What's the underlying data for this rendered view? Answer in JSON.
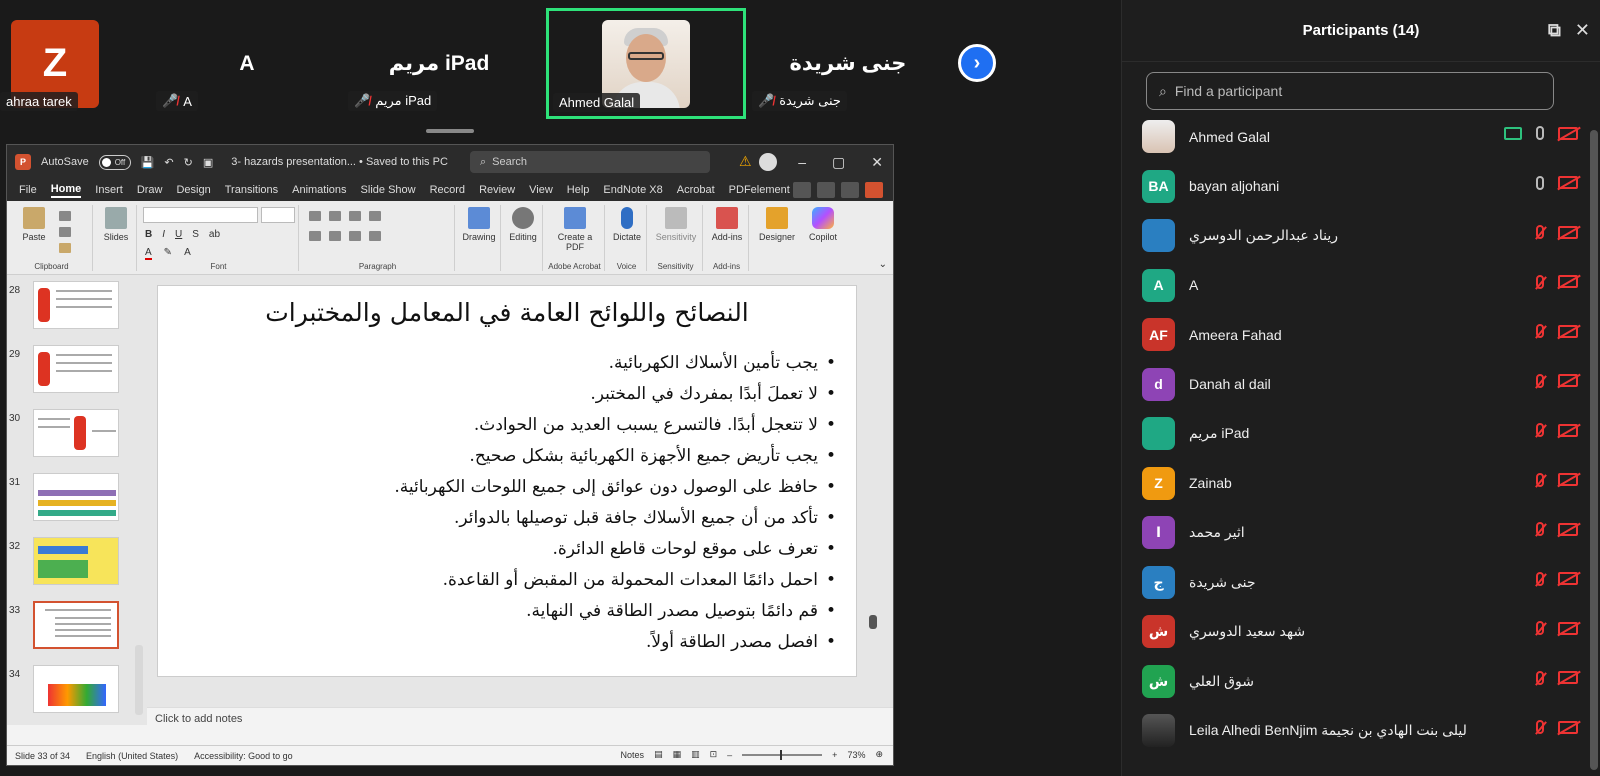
{
  "gallery": {
    "tiles": [
      {
        "name": "Z",
        "label": "ahraa tarek",
        "muted": false
      },
      {
        "name": "A",
        "label": "A",
        "muted": true
      },
      {
        "name": "مريم iPad",
        "label": "مريم iPad",
        "muted": true
      },
      {
        "name": "Ahmed Galal",
        "label": "Ahmed Galal",
        "muted": false,
        "active_speaker": true
      },
      {
        "name": "جنى شريدة",
        "label": "جنى شريدة",
        "muted": true
      }
    ],
    "next_icon": "chevron-right-icon"
  },
  "ppt": {
    "autosave_label": "AutoSave",
    "autosave_state": "Off",
    "file_title": "3- hazards presentation... • Saved to this PC",
    "search_placeholder": "Search",
    "menu": [
      "File",
      "Home",
      "Insert",
      "Draw",
      "Design",
      "Transitions",
      "Animations",
      "Slide Show",
      "Record",
      "Review",
      "View",
      "Help",
      "EndNote X8",
      "Acrobat",
      "PDFelement"
    ],
    "active_menu": "Home",
    "ribbon": {
      "paste": "Paste",
      "clipboard": "Clipboard",
      "slides": "Slides",
      "font": "Font",
      "paragraph": "Paragraph",
      "drawing": "Drawing",
      "editing": "Editing",
      "create_pdf": "Create a PDF",
      "adobe_acrobat": "Adobe Acrobat",
      "dictate": "Dictate",
      "voice": "Voice",
      "sensitivity": "Sensitivity",
      "addins": "Add-ins",
      "designer": "Designer",
      "copilot": "Copilot",
      "font_row": [
        "B",
        "I",
        "U",
        "S",
        "ab"
      ]
    },
    "thumbnails": [
      "28",
      "29",
      "30",
      "31",
      "32",
      "33",
      "34"
    ],
    "selected_thumbnail": "33",
    "slide": {
      "title": "النصائح واللوائح العامة في المعامل والمختبرات",
      "bullets": [
        "يجب تأمين الأسلاك الكهربائية.",
        "لا تعملَ أبدًا بمفردك في المختبر.",
        "لا تتعجل أبدًا. فالتسرع يسبب العديد من الحوادث.",
        "يجب تأريض جميع الأجهزة الكهربائية بشكل صحيح.",
        "حافظ على الوصول دون عوائق إلى جميع اللوحات الكهربائية.",
        "تأكد من أن جميع الأسلاك جافة قبل توصيلها بالدوائر.",
        "تعرف على موقع لوحات قاطع الدائرة.",
        "احمل دائمًا المعدات المحمولة من المقبض أو القاعدة.",
        "قم دائمًا بتوصيل مصدر الطاقة في النهاية.",
        "افصل مصدر الطاقة أولاً."
      ]
    },
    "notes_placeholder": "Click to add notes",
    "status": {
      "slide": "Slide 33 of 34",
      "language": "English (United States)",
      "accessibility": "Accessibility: Good to go",
      "notes": "Notes",
      "zoom": "73%"
    }
  },
  "panel": {
    "title": "Participants (14)",
    "search_placeholder": "Find a participant",
    "participants": [
      {
        "initials": "",
        "name": "Ahmed Galal",
        "color": "#ffffff",
        "photo": true,
        "sharing": true,
        "mic_muted": false
      },
      {
        "initials": "BA",
        "name": "bayan aljohani",
        "color": "#1fa884",
        "mic_muted": false
      },
      {
        "initials": "",
        "name": "ريناد عبدالرحمن الدوسري",
        "color": "#2a7fc1",
        "mic_muted": true
      },
      {
        "initials": "A",
        "name": "A",
        "color": "#1fa884",
        "mic_muted": true
      },
      {
        "initials": "AF",
        "name": "Ameera Fahad",
        "color": "#c9342a",
        "mic_muted": true
      },
      {
        "initials": "d",
        "name": "Danah al dail",
        "color": "#8e44b5",
        "mic_muted": true
      },
      {
        "initials": "",
        "name": "مريم iPad",
        "color": "#1fa884",
        "mic_muted": true
      },
      {
        "initials": "Z",
        "name": "Zainab",
        "color": "#f09a10",
        "mic_muted": true
      },
      {
        "initials": "ا",
        "name": "اثير محمد",
        "color": "#8e44b5",
        "mic_muted": true
      },
      {
        "initials": "ج",
        "name": "جنى شريدة",
        "color": "#2a7fc1",
        "mic_muted": true
      },
      {
        "initials": "ش",
        "name": "شهد سعيد الدوسري",
        "color": "#c9342a",
        "mic_muted": true
      },
      {
        "initials": "ش",
        "name": "شوق العلي",
        "color": "#21a351",
        "mic_muted": true
      },
      {
        "initials": "",
        "name": "Leila Alhedi BenNjim ليلى بنت الهادي بن نجيمة",
        "color": "#333333",
        "photo2": true,
        "mic_muted": true
      }
    ]
  }
}
